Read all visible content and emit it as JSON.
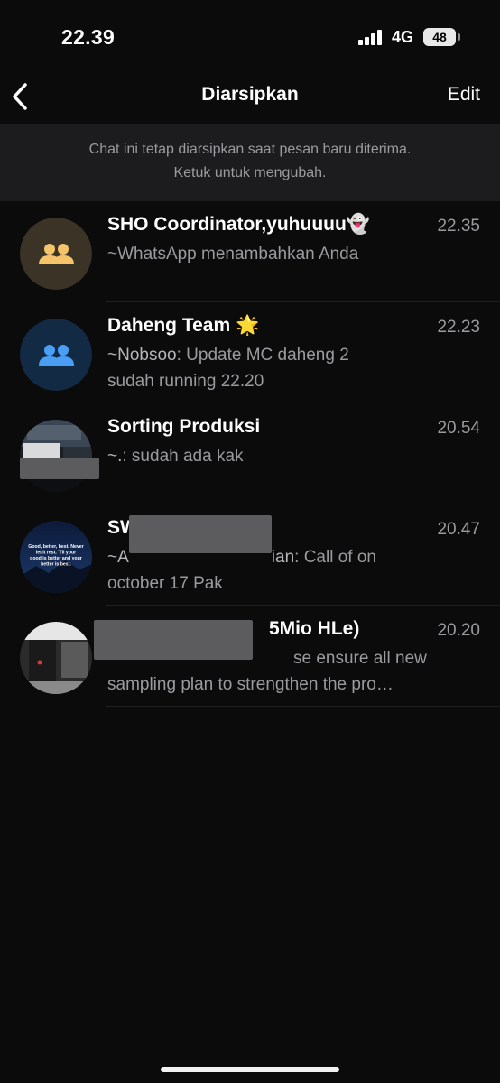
{
  "status_bar": {
    "time": "22.39",
    "network": "4G",
    "battery": "48"
  },
  "nav": {
    "title": "Diarsipkan",
    "edit_label": "Edit"
  },
  "notice": {
    "line1": "Chat ini tetap diarsipkan saat pesan baru diterima.",
    "line2": "Ketuk untuk mengubah."
  },
  "chats": [
    {
      "name": "SHO Coordinator,yuhuuuu👻",
      "time": "22.35",
      "preview": "~WhatsApp menambahkan Anda",
      "avatar": "group-icon-yellow"
    },
    {
      "name": "Daheng Team 🌟",
      "time": "22.23",
      "sender": "~Nobsoo",
      "preview_line1": ": Update MC daheng 2",
      "preview_line2": "sudah running 22.20",
      "avatar": "group-icon-blue"
    },
    {
      "name": "Sorting Produksi",
      "time": "20.54",
      "sender": "~.",
      "preview": ": sudah ada kak",
      "avatar": "photo"
    },
    {
      "name": "SWAT Team",
      "time": "20.47",
      "sender_start": "~A",
      "sender_end": "ian",
      "preview_line1": ": Call of on",
      "preview_line2": "october 17 Pak",
      "avatar_text": "Good, better, best. Never let it rest. 'Til your good is better and your better is best.",
      "avatar": "quote-image"
    },
    {
      "name": "5Mio HLe)",
      "time": "20.20",
      "preview_line1": "se ensure all new",
      "preview_line2": "sampling plan to strengthen the pro…",
      "avatar": "photo"
    }
  ],
  "colors": {
    "background": "#0b0b0b",
    "notice_bg": "#1c1c1e",
    "secondary_text": "#9b9b9f",
    "group_yellow_bg": "#3a3326",
    "group_yellow_fg": "#f5c46a",
    "group_blue_bg": "#132a44",
    "group_blue_fg": "#4a9ff5"
  }
}
